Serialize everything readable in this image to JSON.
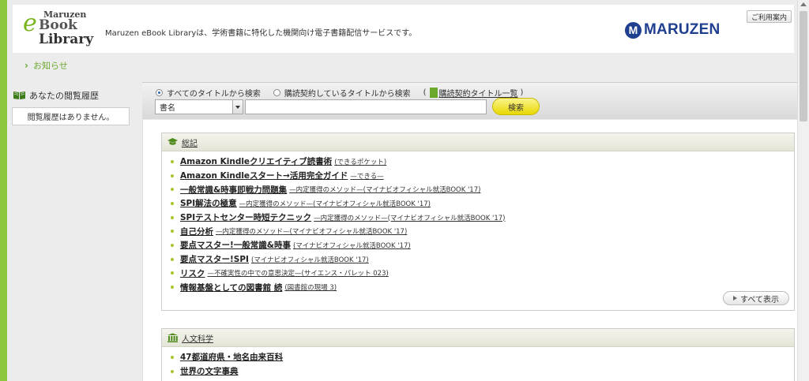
{
  "header": {
    "logo": {
      "top": "Maruzen",
      "e": "e",
      "book": "Book",
      "library": "Library"
    },
    "description": "Maruzen eBook Libraryは、学術書籍に特化した機関向け電子書籍配信サービスです。",
    "brand_mark": "M",
    "brand_text": "MARUZEN",
    "guide_label": "ご利用案内",
    "brand_color": "#1f3f8f",
    "accent_color": "#8cc63f"
  },
  "news": {
    "label": "お知らせ"
  },
  "sidebar": {
    "history_title": "あなたの閲覧履歴",
    "history_empty": "閲覧履歴はありません。"
  },
  "search": {
    "radio_all": "すべてのタイトルから検索",
    "radio_subscribed": "購読契約しているタイトルから検索",
    "paren_open": "(",
    "list_link": "購読契約タイトル一覧",
    "paren_close": ")",
    "field_select": "書名",
    "query_value": "",
    "search_button": "検索"
  },
  "categories": [
    {
      "title": "総記",
      "icon": "graduation-cap-icon",
      "items": [
        {
          "title": "Amazon Kindleクリエイティブ読書術",
          "sub": "(できるポケット)"
        },
        {
          "title": "Amazon Kindleスタート→活用完全ガイド",
          "sub": "—できる—"
        },
        {
          "title": "一般常識&時事即戦力問題集",
          "sub": "—内定獲得のメソッド—(マイナビオフィシャル就活BOOK '17)"
        },
        {
          "title": "SPI解法の極意",
          "sub": "—内定獲得のメソッド—(マイナビオフィシャル就活BOOK '17)"
        },
        {
          "title": "SPIテストセンター時短テクニック",
          "sub": "—内定獲得のメソッド—(マイナビオフィシャル就活BOOK '17)"
        },
        {
          "title": "自己分析",
          "sub": "—内定獲得のメソッド—(マイナビオフィシャル就活BOOK '17)"
        },
        {
          "title": "要点マスター!一般常識&時事",
          "sub": "(マイナビオフィシャル就活BOOK '17)"
        },
        {
          "title": "要点マスター!SPI",
          "sub": "(マイナビオフィシャル就活BOOK '17)"
        },
        {
          "title": "リスク",
          "sub": "—不確実性の中での意思決定—(サイエンス・パレット 023)"
        },
        {
          "title": "情報基盤としての図書館 続",
          "sub": "(図書館の現場 3)"
        }
      ],
      "show_all": "すべて表示"
    },
    {
      "title": "人文科学",
      "icon": "library-building-icon",
      "items": [
        {
          "title": "47都道府県・地名由来百科",
          "sub": ""
        },
        {
          "title": "世界の文字事典",
          "sub": ""
        }
      ]
    }
  ]
}
